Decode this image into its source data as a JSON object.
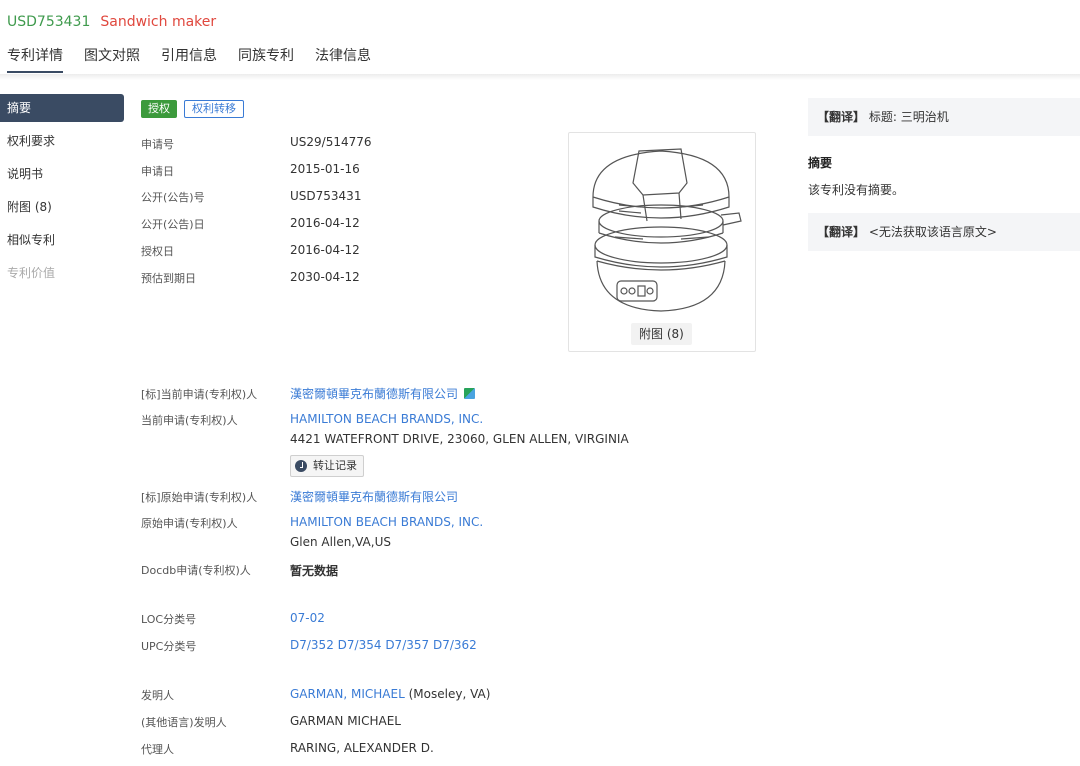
{
  "header": {
    "patent_number": "USD753431",
    "title": "Sandwich maker",
    "tabs": [
      "专利详情",
      "图文对照",
      "引用信息",
      "同族专利",
      "法律信息"
    ]
  },
  "nav": {
    "items": [
      "摘要",
      "权利要求",
      "说明书",
      "附图 (8)",
      "相似专利",
      "专利价值"
    ]
  },
  "badges": {
    "status": "授权",
    "transfer": "权利转移"
  },
  "fields": {
    "app_no_label": "申请号",
    "app_no": "US29/514776",
    "app_date_label": "申请日",
    "app_date": "2015-01-16",
    "pub_no_label": "公开(公告)号",
    "pub_no": "USD753431",
    "pub_date_label": "公开(公告)日",
    "pub_date": "2016-04-12",
    "grant_date_label": "授权日",
    "grant_date": "2016-04-12",
    "expiry_label": "预估到期日",
    "expiry": "2030-04-12"
  },
  "figure": {
    "caption": "附图 (8)"
  },
  "applicants": {
    "std_current_label": "[标]当前申请(专利权)人",
    "std_current": "漢密爾頓畢克布蘭德斯有限公司",
    "current_label": "当前申请(专利权)人",
    "current": "HAMILTON BEACH BRANDS, INC.",
    "current_address": "4421 WATEFRONT DRIVE, 23060, GLEN ALLEN, VIRGINIA",
    "transfer_button": "转让记录",
    "std_original_label": "[标]原始申请(专利权)人",
    "std_original": "漢密爾頓畢克布蘭德斯有限公司",
    "original_label": "原始申请(专利权)人",
    "original": "HAMILTON BEACH BRANDS, INC.",
    "original_address": "Glen Allen,VA,US",
    "docdb_label": "Docdb申请(专利权)人",
    "docdb": "暂无数据"
  },
  "classification": {
    "loc_label": "LOC分类号",
    "loc": "07-02",
    "upc_label": "UPC分类号",
    "upc": [
      "D7/352",
      "D7/354",
      "D7/357",
      "D7/362"
    ]
  },
  "people": {
    "inventor_label": "发明人",
    "inventor": "GARMAN, MICHAEL",
    "inventor_location": "(Moseley, VA)",
    "other_inventor_label": "(其他语言)发明人",
    "other_inventor": "GARMAN MICHAEL",
    "agent_label": "代理人",
    "agent": "RARING, ALEXANDER D."
  },
  "right": {
    "translate_bracket": "【翻译】",
    "title_translation": "标题: 三明治机",
    "abstract_heading": "摘要",
    "abstract_text": "该专利没有摘要。",
    "abstract_translation": "<无法获取该语言原文>"
  }
}
